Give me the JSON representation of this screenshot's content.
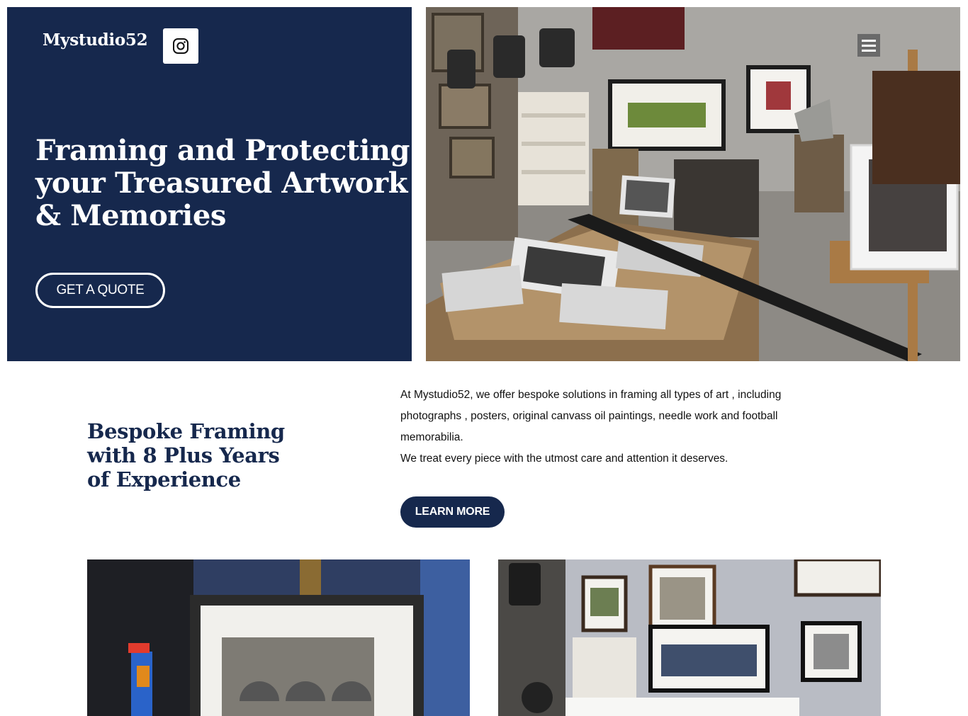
{
  "header": {
    "brand": "Mystudio52",
    "instagram_icon": "instagram-icon",
    "menu_icon": "hamburger-menu-icon"
  },
  "hero": {
    "title": "Framing and Protecting your Treasured Artwork & Memories",
    "cta_label": "GET A QUOTE",
    "background_color": "#16284d"
  },
  "about": {
    "heading": "Bespoke Framing with 8 Plus Years of Experience",
    "paragraph_1": "At Mystudio52, we offer bespoke solutions in framing all types of art , including photographs , posters, original canvass oil paintings, needle work and football memorabilia.",
    "paragraph_2": "We treat every piece with the utmost care and attention it deserves.",
    "cta_label": "LEARN MORE"
  },
  "colors": {
    "navy": "#16284d",
    "white": "#ffffff"
  }
}
